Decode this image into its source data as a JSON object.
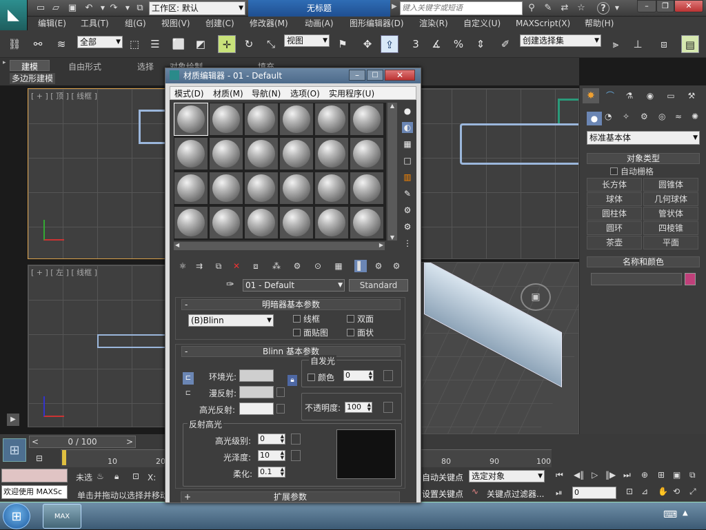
{
  "titlebar": {
    "workspace_label": "工作区: 默认",
    "document_title": "无标题",
    "search_placeholder": "键入关键字或短语"
  },
  "menu": [
    "编辑(E)",
    "工具(T)",
    "组(G)",
    "视图(V)",
    "创建(C)",
    "修改器(M)",
    "动画(A)",
    "图形编辑器(D)",
    "渲染(R)",
    "自定义(U)",
    "MAXScript(X)",
    "帮助(H)"
  ],
  "toolbar": {
    "selection_filter": "全部",
    "ref_coord": "视图",
    "named_selection": "创建选择集",
    "snap_label": "3",
    "percent_label": "%"
  },
  "ribbon": {
    "tabs": [
      "建模",
      "自由形式",
      "选择",
      "对象绘制",
      "填充"
    ],
    "subtab": "多边形建模"
  },
  "viewports": {
    "top_left_label": "[ + ] [ 顶 ] [ 线框 ]",
    "bottom_left_label": "[ + ] [ 左 ] [ 线框 ]"
  },
  "command_panel": {
    "category": "标准基本体",
    "object_type_header": "对象类型",
    "autogrid_label": "自动栅格",
    "buttons": [
      "长方体",
      "圆锥体",
      "球体",
      "几何球体",
      "圆柱体",
      "管状体",
      "圆环",
      "四棱锥",
      "茶壶",
      "平面"
    ],
    "name_color_header": "名称和颜色",
    "object_color": "#c0407a"
  },
  "material_editor": {
    "title": "材质编辑器 - 01 - Default",
    "menus": [
      "模式(D)",
      "材质(M)",
      "导航(N)",
      "选项(O)",
      "实用程序(U)"
    ],
    "material_name": "01 - Default",
    "material_type": "Standard",
    "shader_header": "明暗器基本参数",
    "shader_type": "(B)Blinn",
    "shader_options": [
      "线框",
      "双面",
      "面贴图",
      "面状"
    ],
    "blinn_header": "Blinn 基本参数",
    "self_illum_label": "自发光",
    "color_label": "颜色",
    "self_illum_value": "0",
    "ambient_label": "环境光:",
    "diffuse_label": "漫反射:",
    "specular_label": "高光反射:",
    "opacity_label": "不透明度:",
    "opacity_value": "100",
    "specular_group": "反射高光",
    "spec_level_label": "高光级别:",
    "spec_level_value": "0",
    "gloss_label": "光泽度:",
    "gloss_value": "10",
    "soften_label": "柔化:",
    "soften_value": "0.1",
    "extended_header": "扩展参数"
  },
  "timeline": {
    "frame_display": "0 / 100",
    "ticks": [
      "10",
      "20",
      "80",
      "90",
      "100"
    ]
  },
  "statusbar": {
    "welcome": "欢迎使用 MAXSc",
    "status_prefix": "未选",
    "prompt": "单击并拖动以选择并移动",
    "x_label": "X:",
    "auto_key": "自动关键点",
    "set_key": "设置关键点",
    "key_mode_dropdown": "选定对象",
    "key_filter": "关键点过滤器...",
    "frame_value": "0"
  },
  "taskbar": {
    "app_label": "MAX"
  }
}
